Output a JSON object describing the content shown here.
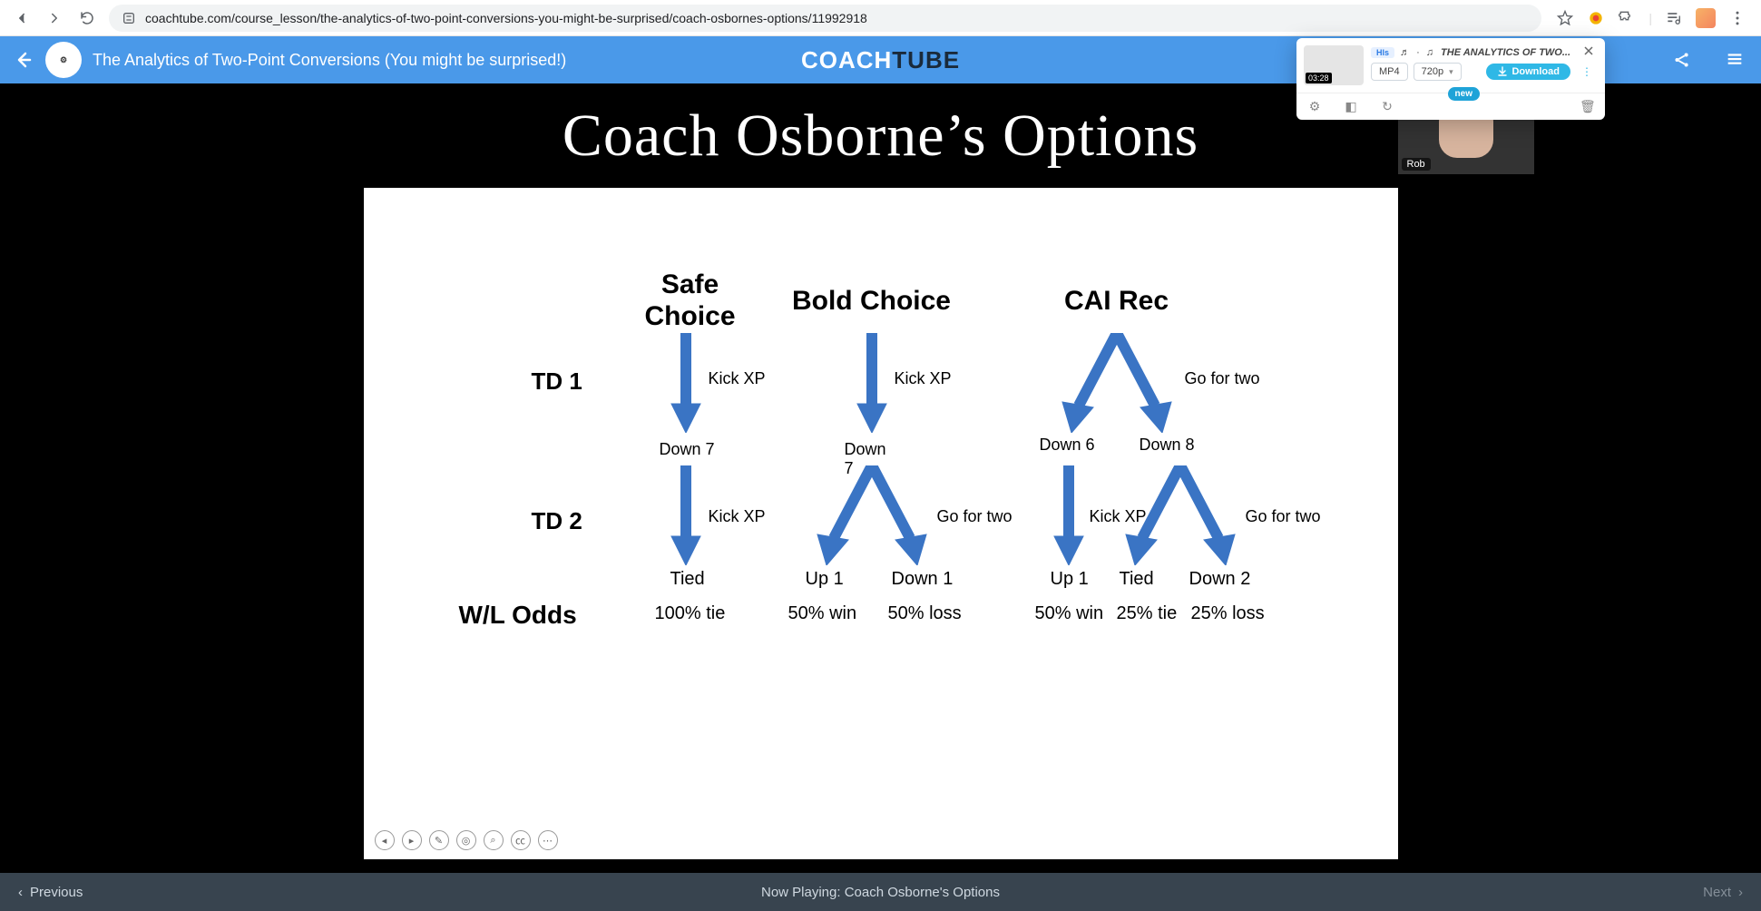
{
  "browser": {
    "url": "coachtube.com/course_lesson/the-analytics-of-two-point-conversions-you-might-be-surprised/coach-osbornes-options/11992918"
  },
  "header": {
    "course_title": "The Analytics of Two-Point Conversions (You might be surprised!)",
    "logo_part1": "COACH",
    "logo_part2": "TUBE"
  },
  "downloader": {
    "badge": "Hls",
    "title_prefix": "♬ · ♫ ",
    "title": "THE ANALYTICS OF TWO...",
    "duration": "03:28",
    "format": "MP4",
    "quality": "720p",
    "button": "Download",
    "new_badge": "new"
  },
  "slide": {
    "title": "Coach Osborne’s Options",
    "headers": {
      "safe": "Safe Choice",
      "bold": "Bold Choice",
      "cai": "CAI Rec"
    },
    "rows": {
      "td1": "TD 1",
      "td2": "TD 2",
      "odds": "W/L Odds"
    },
    "labels": {
      "kick_xp": "Kick XP",
      "go_for_two": "Go for two",
      "down7": "Down 7",
      "down7b": "Down 7",
      "down6": "Down 6",
      "down8": "Down 8",
      "tied": "Tied",
      "up1": "Up 1",
      "down1": "Down 1",
      "up1b": "Up 1",
      "tied_b": "Tied",
      "down2": "Down 2"
    },
    "odds": {
      "safe": "100% tie",
      "bold_win": "50% win",
      "bold_loss": "50% loss",
      "cai_win": "50% win",
      "cai_tie": "25% tie",
      "cai_loss": "25% loss"
    },
    "presenter": "Rob"
  },
  "bottom": {
    "prev": "Previous",
    "next": "Next",
    "now_playing_prefix": "Now Playing: ",
    "now_playing_title": "Coach Osborne's Options"
  },
  "chart_data": {
    "type": "table",
    "title": "Coach Osborne’s Options",
    "row_labels": [
      "TD 1",
      "TD 2",
      "W/L Odds"
    ],
    "columns": [
      {
        "name": "Safe Choice",
        "td1": {
          "action": "Kick XP",
          "outcomes": [
            "Down 7"
          ]
        },
        "td2": {
          "action": "Kick XP",
          "outcomes": [
            "Tied"
          ]
        },
        "odds": [
          "100% tie"
        ]
      },
      {
        "name": "Bold Choice",
        "td1": {
          "action": "Kick XP",
          "outcomes": [
            "Down 7"
          ]
        },
        "td2": {
          "action": "Go for two",
          "outcomes": [
            "Up 1",
            "Down 1"
          ]
        },
        "odds": [
          "50% win",
          "50% loss"
        ]
      },
      {
        "name": "CAI Rec",
        "td1": {
          "action": "Go for two",
          "outcomes": [
            "Down 6",
            "Down 8"
          ]
        },
        "td2": {
          "actions": [
            "Kick XP",
            "Go for two"
          ],
          "outcomes": [
            "Up 1",
            "Tied",
            "Down 2"
          ]
        },
        "odds": [
          "50% win",
          "25% tie",
          "25% loss"
        ]
      }
    ]
  }
}
